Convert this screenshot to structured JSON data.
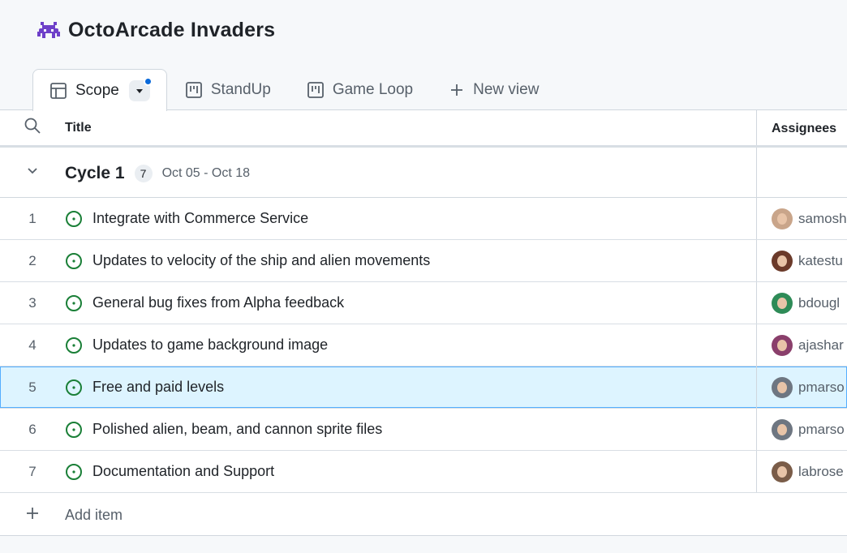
{
  "project": {
    "title": "OctoArcade Invaders",
    "icon": "space-invader-icon"
  },
  "tabs": [
    {
      "label": "Scope",
      "icon": "table-icon",
      "active": true
    },
    {
      "label": "StandUp",
      "icon": "board-icon",
      "active": false
    },
    {
      "label": "Game Loop",
      "icon": "board-icon",
      "active": false
    },
    {
      "label": "New view",
      "icon": "plus-icon",
      "active": false
    }
  ],
  "table": {
    "columns": {
      "title": "Title",
      "assignees": "Assignees"
    },
    "group": {
      "name": "Cycle 1",
      "count": "7",
      "dates": "Oct 05 - Oct 18"
    },
    "items": [
      {
        "num": "1",
        "title": "Integrate with Commerce Service",
        "assignee": "samosh",
        "avatar_color": "#c9a58a"
      },
      {
        "num": "2",
        "title": "Updates to velocity of the ship and alien movements",
        "assignee": "katestu",
        "avatar_color": "#6b3a2a"
      },
      {
        "num": "3",
        "title": "General bug fixes from Alpha feedback",
        "assignee": "bdougl",
        "avatar_color": "#2e8b57"
      },
      {
        "num": "4",
        "title": "Updates to game background image",
        "assignee": "ajashar",
        "avatar_color": "#8a3f6b"
      },
      {
        "num": "5",
        "title": "Free and paid levels",
        "assignee": "pmarso",
        "avatar_color": "#6e7681",
        "selected": true
      },
      {
        "num": "6",
        "title": "Polished alien, beam, and cannon sprite files",
        "assignee": "pmarso",
        "avatar_color": "#6e7681"
      },
      {
        "num": "7",
        "title": "Documentation and Support",
        "assignee": "labrose",
        "avatar_color": "#7a5c48"
      }
    ],
    "add_item_label": "Add item"
  },
  "colors": {
    "status_open": "#1a7f37",
    "accent": "#0969da",
    "selected_row": "#ddf4ff"
  }
}
